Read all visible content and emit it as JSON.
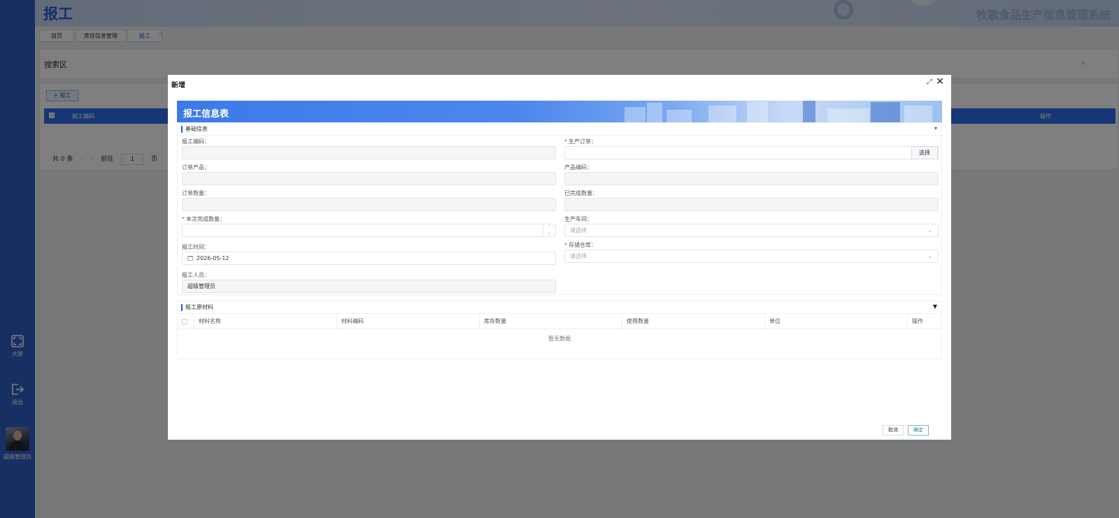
{
  "app": {
    "title": "报工",
    "system_name": "牧歌食品生产信息管理系统"
  },
  "sidebar": {
    "tools": [
      {
        "label": "大屏",
        "icon": "fullscreen-icon"
      },
      {
        "label": "退出",
        "icon": "logout-icon"
      }
    ],
    "user": {
      "name": "超级管理员"
    }
  },
  "tabs": [
    {
      "label": "首页"
    },
    {
      "label": "库存信息管理"
    },
    {
      "label": "报工",
      "active": true
    }
  ],
  "search": {
    "title": "搜索区"
  },
  "toolbar": {
    "add_label": "+ 报工"
  },
  "grid": {
    "columns": [
      "报工编码",
      "操作"
    ]
  },
  "pager": {
    "total": "共 0 条",
    "goto": "前往",
    "page": "1",
    "page_suffix": "页"
  },
  "modal": {
    "title": "新增",
    "banner_title": "报工信息表",
    "basic_section": "基础信息",
    "fields": {
      "report_code": {
        "label": "报工编码：",
        "value": ""
      },
      "production_order": {
        "label": "生产订单：",
        "required": true,
        "value": "",
        "button": "选择"
      },
      "order_product": {
        "label": "订单产品：",
        "value": ""
      },
      "product_code": {
        "label": "产品编码：",
        "value": ""
      },
      "order_qty": {
        "label": "订单数量：",
        "value": ""
      },
      "completed_qty": {
        "label": "已完成数量：",
        "value": ""
      },
      "current_qty": {
        "label": "本次完成数量：",
        "required": true,
        "value": ""
      },
      "workshop": {
        "label": "生产车间：",
        "placeholder": "请选择"
      },
      "report_time": {
        "label": "报工时间：",
        "value": "2026-05-12"
      },
      "warehouse": {
        "label": "存储仓库：",
        "required": true,
        "placeholder": "请选择"
      },
      "reporter": {
        "label": "报工人员：",
        "value": "超级管理员"
      }
    },
    "materials_section": "报工原材料",
    "materials_columns": [
      "材料名称",
      "材料编码",
      "库存数量",
      "使用数量",
      "单位",
      "操作"
    ],
    "materials_empty": "暂无数据",
    "cancel_label": "取消",
    "confirm_label": "确定"
  },
  "colors": {
    "sidebar": "#2f5fc4",
    "primary": "#2a5bd7",
    "required": "#e04545"
  }
}
